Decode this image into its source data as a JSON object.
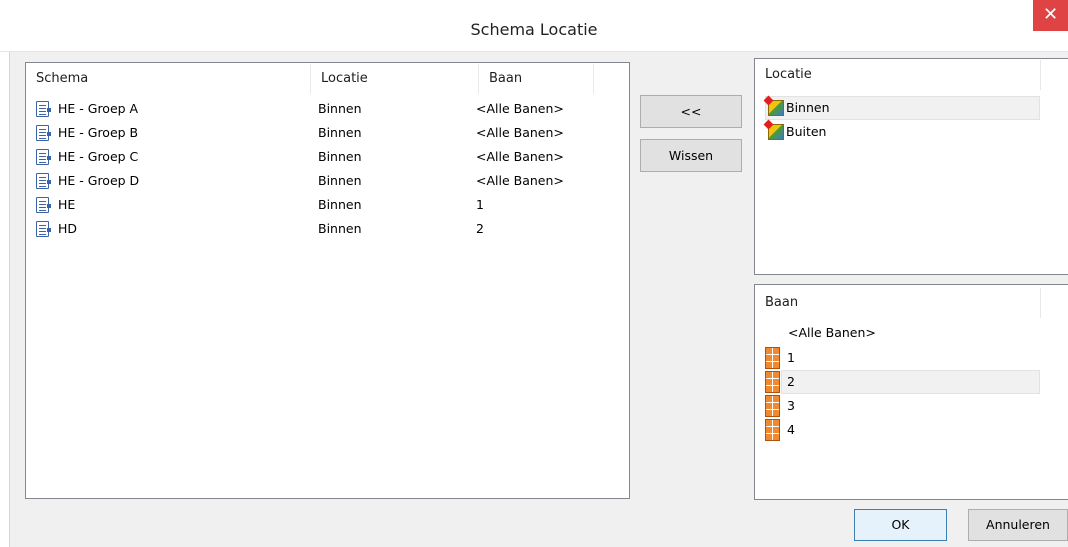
{
  "window": {
    "title": "Schema Locatie",
    "close_glyph": "✕"
  },
  "schema_list": {
    "columns": [
      "Schema",
      "Locatie",
      "Baan"
    ],
    "rows": [
      {
        "schema": "HE - Groep A",
        "locatie": "Binnen",
        "baan": "<Alle Banen>",
        "icon": "document-icon"
      },
      {
        "schema": "HE - Groep B",
        "locatie": "Binnen",
        "baan": "<Alle Banen>",
        "icon": "document-icon"
      },
      {
        "schema": "HE - Groep C",
        "locatie": "Binnen",
        "baan": "<Alle Banen>",
        "icon": "document-icon"
      },
      {
        "schema": "HE - Groep D",
        "locatie": "Binnen",
        "baan": "<Alle Banen>",
        "icon": "document-icon"
      },
      {
        "schema": "HE",
        "locatie": "Binnen",
        "baan": "1",
        "icon": "document-icon"
      },
      {
        "schema": "HD",
        "locatie": "Binnen",
        "baan": "2",
        "icon": "document-icon"
      }
    ]
  },
  "buttons": {
    "assign": "<<",
    "clear": "Wissen",
    "ok": "OK",
    "cancel": "Annuleren"
  },
  "locatie_list": {
    "header": "Locatie",
    "items": [
      {
        "label": "Binnen",
        "icon": "location-icon",
        "selected": true
      },
      {
        "label": "Buiten",
        "icon": "location-icon",
        "selected": false
      }
    ]
  },
  "baan_list": {
    "header": "Baan",
    "items": [
      {
        "label": "<Alle Banen>",
        "icon": null,
        "selected": false
      },
      {
        "label": "1",
        "icon": "court-icon",
        "selected": false
      },
      {
        "label": "2",
        "icon": "court-icon",
        "selected": true
      },
      {
        "label": "3",
        "icon": "court-icon",
        "selected": false
      },
      {
        "label": "4",
        "icon": "court-icon",
        "selected": false
      }
    ]
  },
  "colors": {
    "close_button": "#e04343",
    "dialog_bg": "#f0f0f0",
    "panel_border": "#828790"
  }
}
